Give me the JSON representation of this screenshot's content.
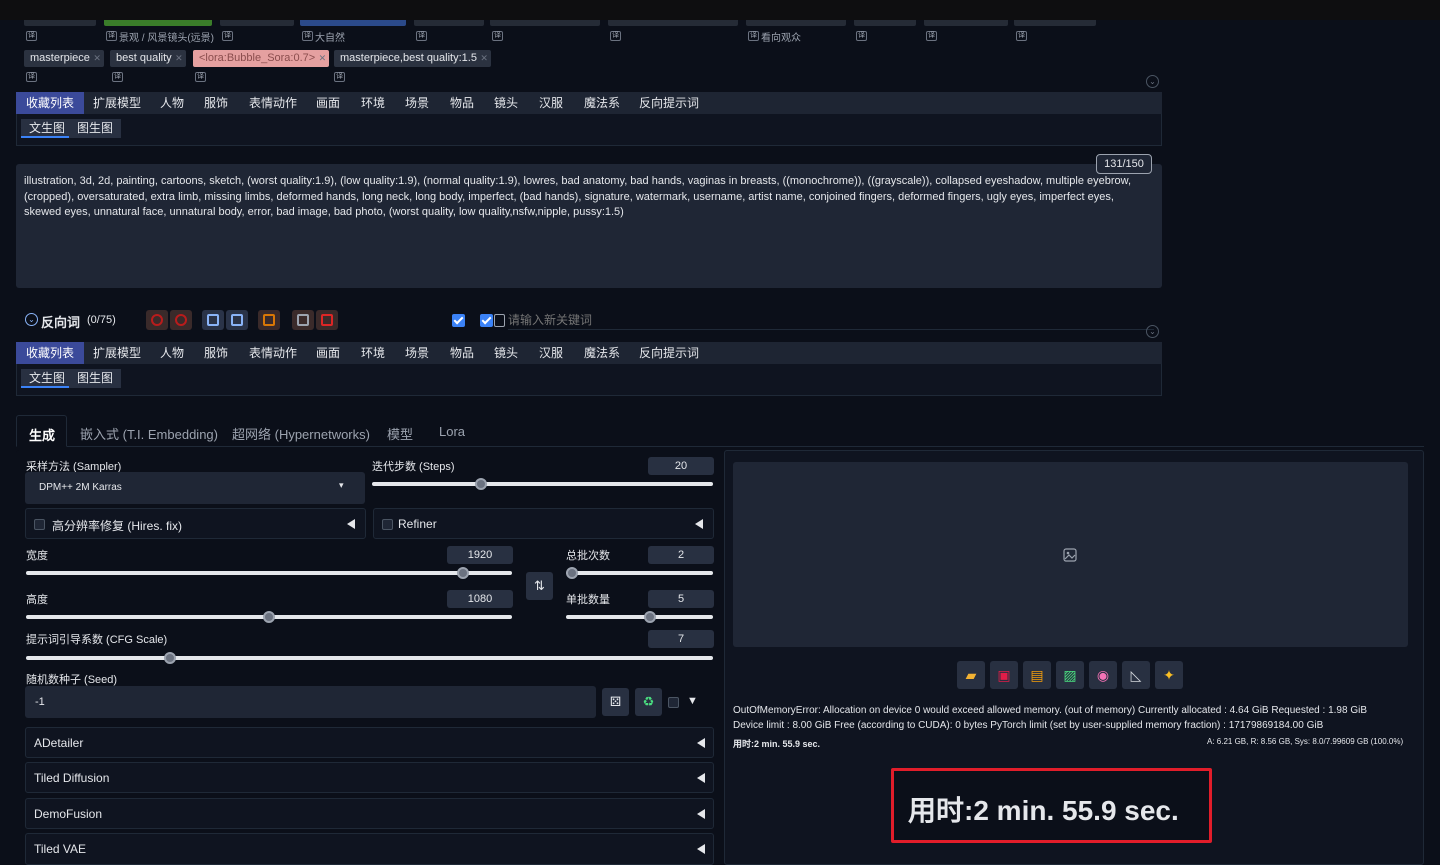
{
  "top_chips_row1": [
    {
      "mini_label": "景观 / 风景镜头(远景)"
    },
    {
      "mini_label": "大自然"
    },
    {
      "mini_label": "看向观众"
    }
  ],
  "chips": [
    {
      "text": "masterpiece",
      "type": "normal"
    },
    {
      "text": "best quality",
      "type": "normal"
    },
    {
      "text": "<lora:Bubble_Sora:0.7>",
      "type": "lora"
    },
    {
      "text": "masterpiece,best quality:1.5",
      "type": "normal"
    }
  ],
  "categories": [
    "收藏列表",
    "扩展模型",
    "人物",
    "服饰",
    "表情动作",
    "画面",
    "环境",
    "场景",
    "物品",
    "镜头",
    "汉服",
    "魔法系",
    "反向提示词"
  ],
  "subtabs": [
    "文生图",
    "图生图"
  ],
  "negative_prompt": {
    "counter": "131/150",
    "text": "illustration, 3d, 2d, painting, cartoons, sketch, (worst quality:1.9), (low quality:1.9), (normal quality:1.9), lowres, bad anatomy, bad hands, vaginas in breasts, ((monochrome)), ((grayscale)), collapsed eyeshadow, multiple eyebrow, (cropped), oversaturated, extra limb, missing limbs, deformed hands, long neck, long body, imperfect, (bad hands), signature, watermark, username, artist name, conjoined fingers, deformed fingers, ugly eyes, imperfect eyes, skewed eyes, unnatural face, unnatural body, error, bad image, bad photo, (worst quality, low quality,nsfw,nipple, pussy:1.5)"
  },
  "neg_section": {
    "title": "反向词",
    "count": "(0/75)",
    "keyword_placeholder": "请输入新关键词"
  },
  "main_tabs": [
    "生成",
    "嵌入式 (T.I. Embedding)",
    "超网络 (Hypernetworks)",
    "模型",
    "Lora"
  ],
  "sampler": {
    "label": "采样方法 (Sampler)",
    "value": "DPM++ 2M Karras"
  },
  "steps": {
    "label": "迭代步数 (Steps)",
    "value": "20",
    "fraction": 0.32
  },
  "hires": {
    "label": "高分辨率修复 (Hires. fix)"
  },
  "refiner": {
    "label": "Refiner"
  },
  "width": {
    "label": "宽度",
    "value": "1920",
    "fraction": 0.9
  },
  "height": {
    "label": "高度",
    "value": "1080",
    "fraction": 0.5
  },
  "batch_count": {
    "label": "总批次数",
    "value": "2",
    "fraction": 0.04
  },
  "batch_size": {
    "label": "单批数量",
    "value": "5",
    "fraction": 0.57
  },
  "swap_icon": "⇅",
  "cfg": {
    "label": "提示词引导系数 (CFG Scale)",
    "value": "7",
    "fraction": 0.21
  },
  "seed": {
    "label": "随机数种子 (Seed)",
    "value": "-1"
  },
  "accordions": [
    "ADetailer",
    "Tiled Diffusion",
    "DemoFusion",
    "Tiled VAE"
  ],
  "output": {
    "toolbar_icons": [
      "folder-icon",
      "save-icon",
      "zip-icon",
      "image-icon",
      "palette-icon",
      "ruler-icon",
      "sparkle-icon"
    ],
    "error_line1": "OutOfMemoryError: Allocation on device 0 would exceed allowed memory. (out of memory) Currently allocated : 4.64 GiB Requested : 1.98 GiB",
    "error_line2": "Device limit : 8.00 GiB Free (according to CUDA): 0 bytes PyTorch limit (set by user-supplied memory fraction) : 17179869184.00 GiB",
    "time_small": "用时:2 min. 55.9 sec.",
    "memory": "A: 6.21 GB, R: 8.56 GB, Sys: 8.0/7.99609 GB (100.0%)",
    "time_big": "用时:2 min. 55.9 sec.",
    "highlight_color": "#e11d2a"
  }
}
